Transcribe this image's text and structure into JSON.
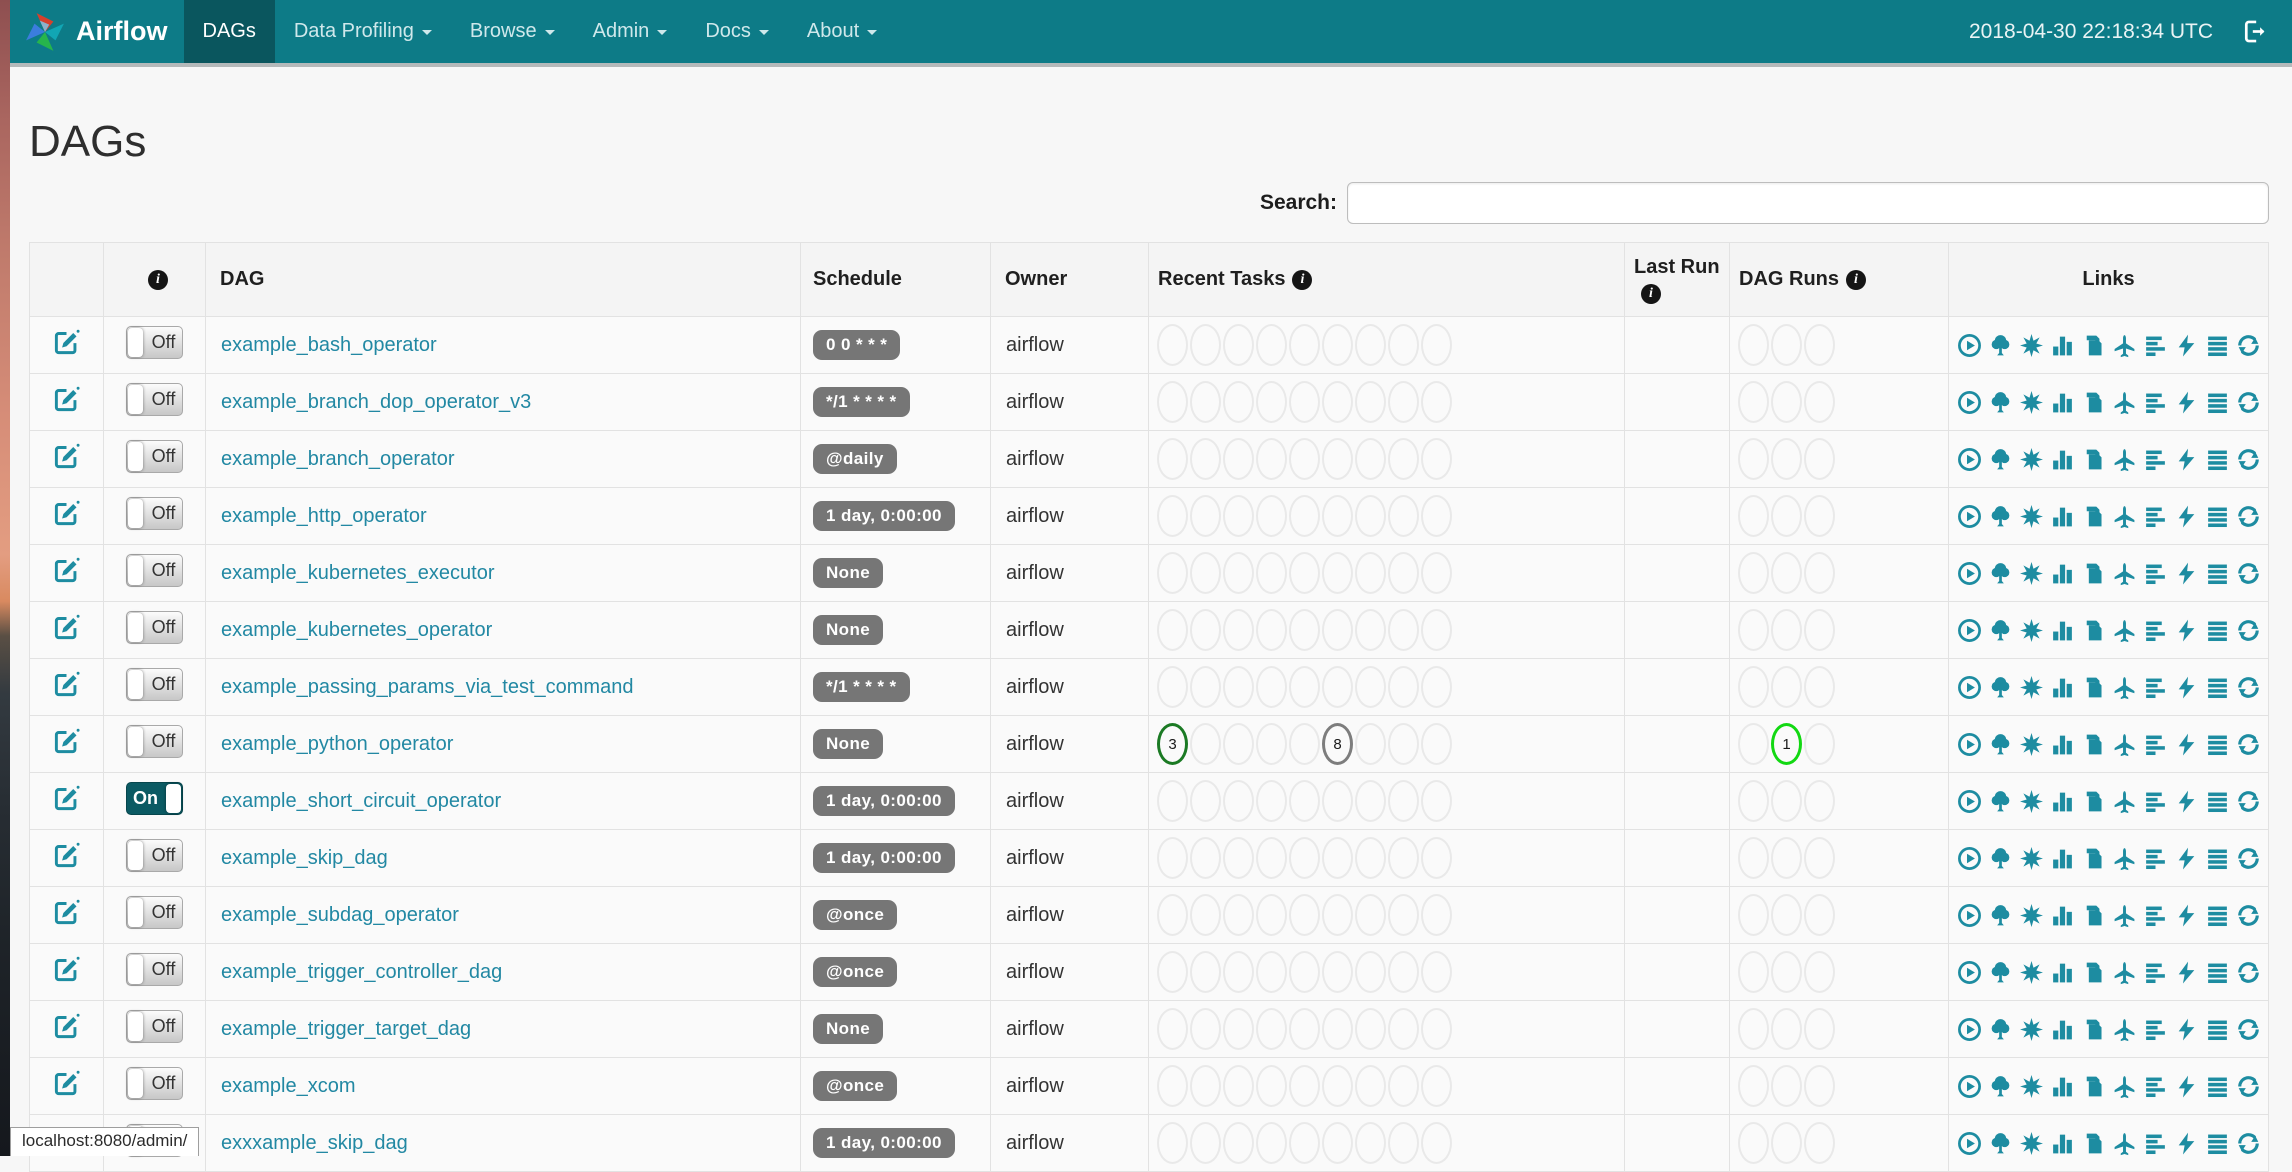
{
  "page": {
    "title": "DAGs",
    "status_bar": "localhost:8080/admin/"
  },
  "navbar": {
    "brand": "Airflow",
    "clock": "2018-04-30 22:18:34 UTC",
    "items": [
      {
        "label": "DAGs",
        "active": true,
        "caret": false
      },
      {
        "label": "Data Profiling",
        "active": false,
        "caret": true
      },
      {
        "label": "Browse",
        "active": false,
        "caret": true
      },
      {
        "label": "Admin",
        "active": false,
        "caret": true
      },
      {
        "label": "Docs",
        "active": false,
        "caret": true
      },
      {
        "label": "About",
        "active": false,
        "caret": true
      }
    ]
  },
  "search": {
    "label": "Search:",
    "value": ""
  },
  "colors": {
    "navbar": "#0d7b87",
    "navbar_active": "#0a565e",
    "accent": "#1d8ca1",
    "link": "#2288a3",
    "badge_bg": "#767676",
    "success": "#1b7a24",
    "running": "#12d812",
    "no_status": "#7d7d7d",
    "empty_slot": "#e9e9e9"
  },
  "table": {
    "columns": [
      "",
      "",
      "DAG",
      "Schedule",
      "Owner",
      "Recent Tasks",
      "Last Run",
      "DAG Runs",
      "Links"
    ],
    "toggle_labels": {
      "on": "On",
      "off": "Off"
    },
    "recent_task_slots": 9,
    "dag_run_slots": 3,
    "links": [
      "trigger-dag",
      "tree-view",
      "graph-view",
      "task-duration",
      "task-tries",
      "landing-times",
      "gantt-view",
      "code-view",
      "logs",
      "refresh"
    ],
    "rows": [
      {
        "name": "example_bash_operator",
        "schedule": "0 0 * * *",
        "owner": "airflow",
        "enabled": false,
        "recent_tasks": [],
        "dag_runs": []
      },
      {
        "name": "example_branch_dop_operator_v3",
        "schedule": "*/1 * * * *",
        "owner": "airflow",
        "enabled": false,
        "recent_tasks": [],
        "dag_runs": []
      },
      {
        "name": "example_branch_operator",
        "schedule": "@daily",
        "owner": "airflow",
        "enabled": false,
        "recent_tasks": [],
        "dag_runs": []
      },
      {
        "name": "example_http_operator",
        "schedule": "1 day, 0:00:00",
        "owner": "airflow",
        "enabled": false,
        "recent_tasks": [],
        "dag_runs": []
      },
      {
        "name": "example_kubernetes_executor",
        "schedule": "None",
        "owner": "airflow",
        "enabled": false,
        "recent_tasks": [],
        "dag_runs": []
      },
      {
        "name": "example_kubernetes_operator",
        "schedule": "None",
        "owner": "airflow",
        "enabled": false,
        "recent_tasks": [],
        "dag_runs": []
      },
      {
        "name": "example_passing_params_via_test_command",
        "schedule": "*/1 * * * *",
        "owner": "airflow",
        "enabled": false,
        "recent_tasks": [],
        "dag_runs": []
      },
      {
        "name": "example_python_operator",
        "schedule": "None",
        "owner": "airflow",
        "enabled": false,
        "recent_tasks": [
          {
            "slot": 0,
            "count": "3",
            "status": "success"
          },
          {
            "slot": 5,
            "count": "8",
            "status": "no_status"
          }
        ],
        "dag_runs": [
          {
            "slot": 1,
            "count": "1",
            "status": "running"
          }
        ]
      },
      {
        "name": "example_short_circuit_operator",
        "schedule": "1 day, 0:00:00",
        "owner": "airflow",
        "enabled": true,
        "recent_tasks": [],
        "dag_runs": []
      },
      {
        "name": "example_skip_dag",
        "schedule": "1 day, 0:00:00",
        "owner": "airflow",
        "enabled": false,
        "recent_tasks": [],
        "dag_runs": []
      },
      {
        "name": "example_subdag_operator",
        "schedule": "@once",
        "owner": "airflow",
        "enabled": false,
        "recent_tasks": [],
        "dag_runs": []
      },
      {
        "name": "example_trigger_controller_dag",
        "schedule": "@once",
        "owner": "airflow",
        "enabled": false,
        "recent_tasks": [],
        "dag_runs": []
      },
      {
        "name": "example_trigger_target_dag",
        "schedule": "None",
        "owner": "airflow",
        "enabled": false,
        "recent_tasks": [],
        "dag_runs": []
      },
      {
        "name": "example_xcom",
        "schedule": "@once",
        "owner": "airflow",
        "enabled": false,
        "recent_tasks": [],
        "dag_runs": []
      },
      {
        "name": "exxxample_skip_dag",
        "schedule": "1 day, 0:00:00",
        "owner": "airflow",
        "enabled": false,
        "recent_tasks": [],
        "dag_runs": []
      }
    ]
  }
}
